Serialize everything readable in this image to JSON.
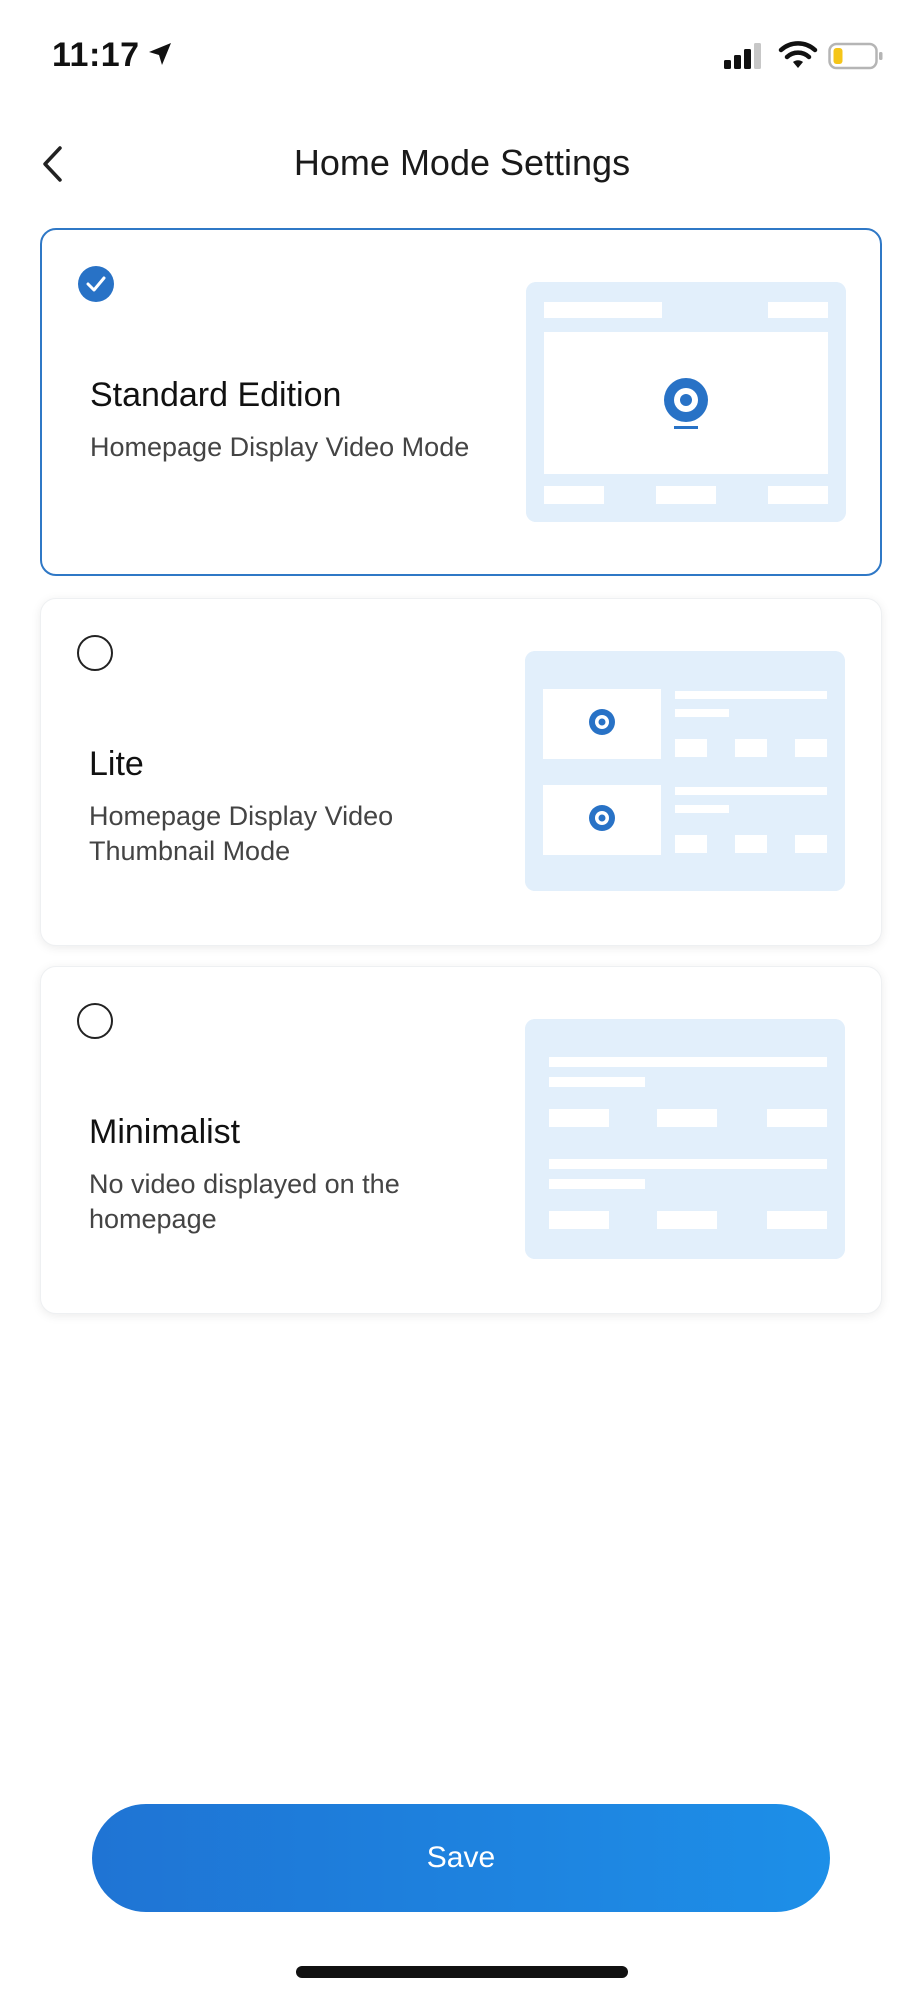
{
  "status_bar": {
    "time": "11:17",
    "icons": [
      "location-arrow-icon",
      "cellular-signal-icon",
      "wifi-icon",
      "battery-low-icon"
    ],
    "battery_color": "#f5c518"
  },
  "header": {
    "title": "Home Mode Settings",
    "back_icon": "chevron-left-icon"
  },
  "options": [
    {
      "title": "Standard Edition",
      "description": "Homepage Display Video Mode",
      "selected": true,
      "preview": "standard-layout"
    },
    {
      "title": "Lite",
      "description": "Homepage Display Video Thumbnail Mode",
      "selected": false,
      "preview": "thumbnail-layout"
    },
    {
      "title": "Minimalist",
      "description": "No video displayed on the homepage",
      "selected": false,
      "preview": "list-layout"
    }
  ],
  "save_label": "Save",
  "colors": {
    "accent": "#2872c6",
    "preview_bg": "#e2effb",
    "button_gradient": [
      "#1f74d4",
      "#1d8fe8"
    ]
  }
}
